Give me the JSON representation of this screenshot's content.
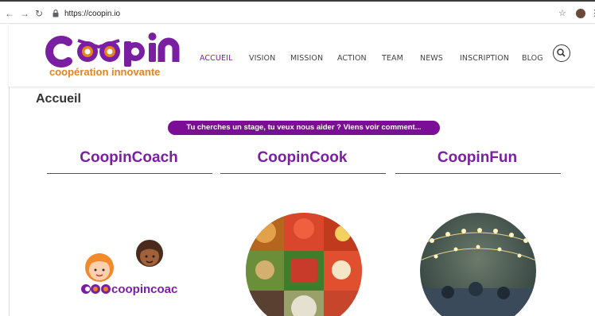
{
  "browser": {
    "url": "https://coopin.io",
    "icons": [
      "back-icon",
      "forward-icon",
      "reload-icon",
      "lock-icon",
      "star-icon",
      "profile-avatar",
      "menu-icon"
    ]
  },
  "header": {
    "logo_text": "coopin",
    "logo_tagline": "coopération innovante",
    "menu": [
      {
        "label": "ACCUEIL",
        "active": true
      },
      {
        "label": "VISION",
        "active": false
      },
      {
        "label": "MISSION",
        "active": false
      },
      {
        "label": "ACTION",
        "active": false
      },
      {
        "label": "TEAM",
        "active": false
      },
      {
        "label": "NEWS",
        "active": false
      },
      {
        "label": "INSCRIPTION",
        "active": false
      },
      {
        "label": "BLOG",
        "active": false
      }
    ]
  },
  "page": {
    "title": "Accueil",
    "cta": "Tu cherches un stage, tu veux nous aider ? Viens voir comment...",
    "columns": [
      {
        "title": "CoopinCoach",
        "image_text": "coopincoach"
      },
      {
        "title": "CoopinCook"
      },
      {
        "title": "CoopinFun"
      }
    ]
  },
  "colors": {
    "brand_purple": "#7b1fa2",
    "brand_orange": "#e8821e",
    "pill_bg": "#7b0d96"
  }
}
